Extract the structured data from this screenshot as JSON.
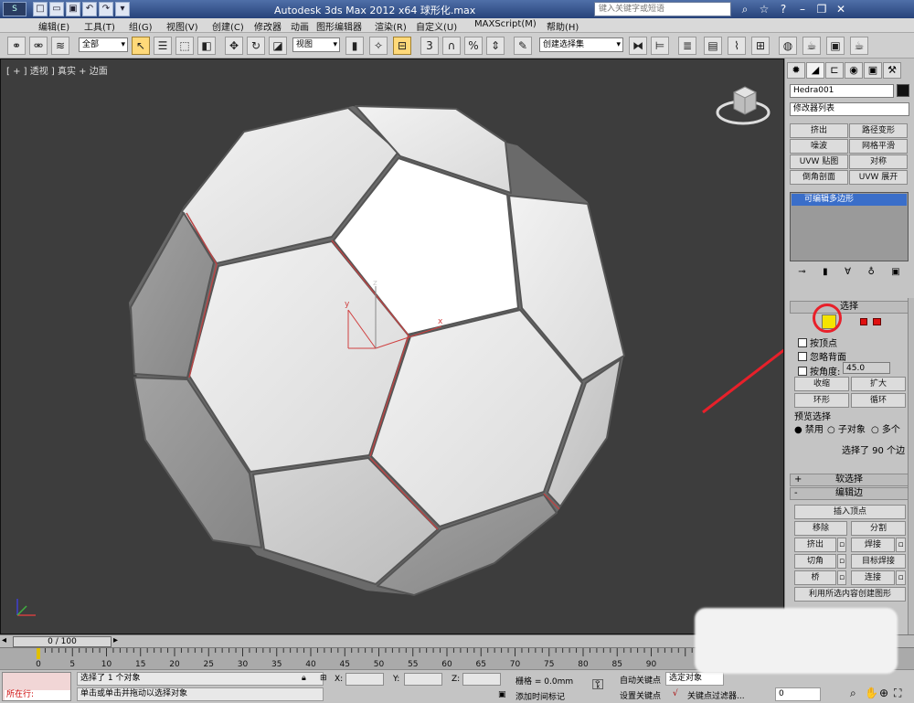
{
  "titlebar": {
    "title": "Autodesk 3ds Max  2012 x64      球形化.max",
    "search_placeholder": "键入关键字或短语"
  },
  "menu": [
    "编辑(E)",
    "工具(T)",
    "组(G)",
    "视图(V)",
    "创建(C)",
    "修改器",
    "动画",
    "图形编辑器",
    "渲染(R)",
    "自定义(U)",
    "MAXScript(M)",
    "帮助(H)"
  ],
  "toolbar": {
    "selection_filter": "全部",
    "reference_coord": "视图",
    "named_selection": "创建选择集",
    "angle_snap_label": "3",
    "percent_snap_label": "%"
  },
  "viewport": {
    "label": "[ + ] 透视 ] 真实 + 边面",
    "axis_x": "x",
    "axis_y": "y",
    "axis_z": "z"
  },
  "cmdpanel": {
    "object_name": "Hedra001",
    "modifier_list": "修改器列表",
    "modifier_buttons": [
      "挤出",
      "路径变形",
      "噪波",
      "网格平滑",
      "UVW 贴图",
      "对称",
      "倒角剖面",
      "UVW 展开"
    ],
    "stack_item": "可编辑多边形",
    "selection": {
      "title": "选择",
      "by_vertex": "按顶点",
      "ignore_backfacing": "忽略背面",
      "by_angle": "按角度:",
      "angle_value": "45.0",
      "shrink": "收缩",
      "grow": "扩大",
      "ring": "环形",
      "loop": "循环",
      "preview_title": "预览选择",
      "preview_off": "禁用",
      "preview_subobj": "子对象",
      "preview_multi": "多个",
      "selected_count": "选择了 90 个边"
    },
    "soft_selection": "软选择",
    "edit_edges": {
      "title": "编辑边",
      "insert_vertex": "插入顶点",
      "remove": "移除",
      "split": "分割",
      "extrude": "挤出",
      "weld": "焊接",
      "chamfer": "切角",
      "target_weld": "目标焊接",
      "bridge": "桥",
      "connect": "连接",
      "create_shape": "利用所选内容创建图形"
    }
  },
  "timeline": {
    "frame_display": "0 / 100",
    "ticks": [
      "0",
      "5",
      "10",
      "15",
      "20",
      "25",
      "30",
      "35",
      "40",
      "45",
      "50",
      "55",
      "60",
      "65",
      "70",
      "75",
      "80",
      "85",
      "90"
    ]
  },
  "status": {
    "listener_text": "所在行:",
    "message1": "选择了 1 个对象",
    "message2": "单击或单击并拖动以选择对象",
    "x_label": "X:",
    "y_label": "Y:",
    "z_label": "Z:",
    "grid": "栅格 = 0.0mm",
    "add_time_tag": "添加时间标记",
    "auto_key": "自动关键点",
    "set_key": "设置关键点",
    "selected": "选定对象",
    "key_filters": "关键点过滤器...",
    "frame": "0"
  },
  "colors": {
    "viewport_bg": "#3d3d3d",
    "annotation_red": "#e8202a",
    "highlight_yellow": "#f5e400"
  }
}
